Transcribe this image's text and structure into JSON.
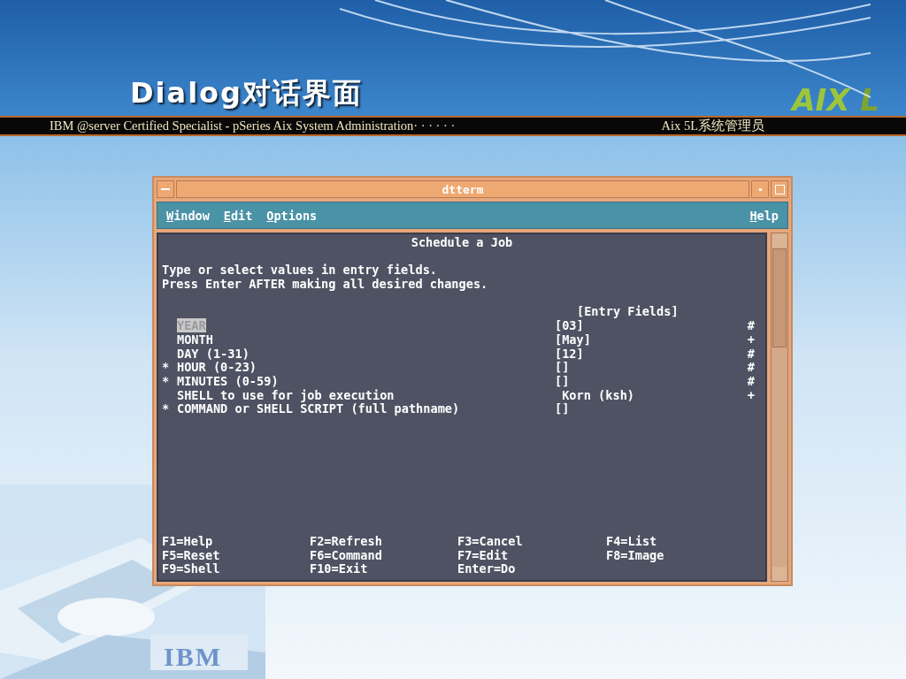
{
  "slide": {
    "title": "Dialog对话界面",
    "banner": "IBM @server Certified Specialist - pSeries Aix System Administration· · · · · ·",
    "course": "Aix 5L系统管理员",
    "logo": "AIX",
    "logo_2": "L",
    "footer_logo": "IBM"
  },
  "window": {
    "title": "dtterm",
    "menus": [
      {
        "label": "Window"
      },
      {
        "label": "Edit"
      },
      {
        "label": "Options"
      }
    ],
    "help_menu": "Help"
  },
  "form": {
    "title": "Schedule a Job",
    "instructions": [
      "Type or select values in entry fields.",
      "Press Enter AFTER making all desired changes."
    ],
    "column_header": "[Entry Fields]",
    "fields": [
      {
        "label": "YEAR",
        "selected": true,
        "value": "[03]",
        "suffix": "#"
      },
      {
        "label": "MONTH",
        "selected": false,
        "value": "[May]",
        "suffix": "+"
      },
      {
        "label": "DAY (1-31)",
        "selected": false,
        "value": "[12]",
        "suffix": "#"
      },
      {
        "mark": "*",
        "label": "HOUR (0-23)",
        "selected": false,
        "value": "[]",
        "suffix": "#"
      },
      {
        "mark": "*",
        "label": "MINUTES (0-59)",
        "selected": false,
        "value": "[]",
        "suffix": "#"
      },
      {
        "label": "SHELL to use for job execution",
        "selected": false,
        "value": " Korn (ksh)",
        "suffix": "+"
      },
      {
        "mark": "*",
        "label": "COMMAND or SHELL SCRIPT (full pathname)",
        "selected": false,
        "value": "[]"
      }
    ]
  },
  "function_keys": [
    "F1=Help",
    "F2=Refresh",
    "F3=Cancel",
    "F4=List",
    "F5=Reset",
    "F6=Command",
    "F7=Edit",
    "F8=Image",
    "F9=Shell",
    "F10=Exit",
    "Enter=Do"
  ]
}
